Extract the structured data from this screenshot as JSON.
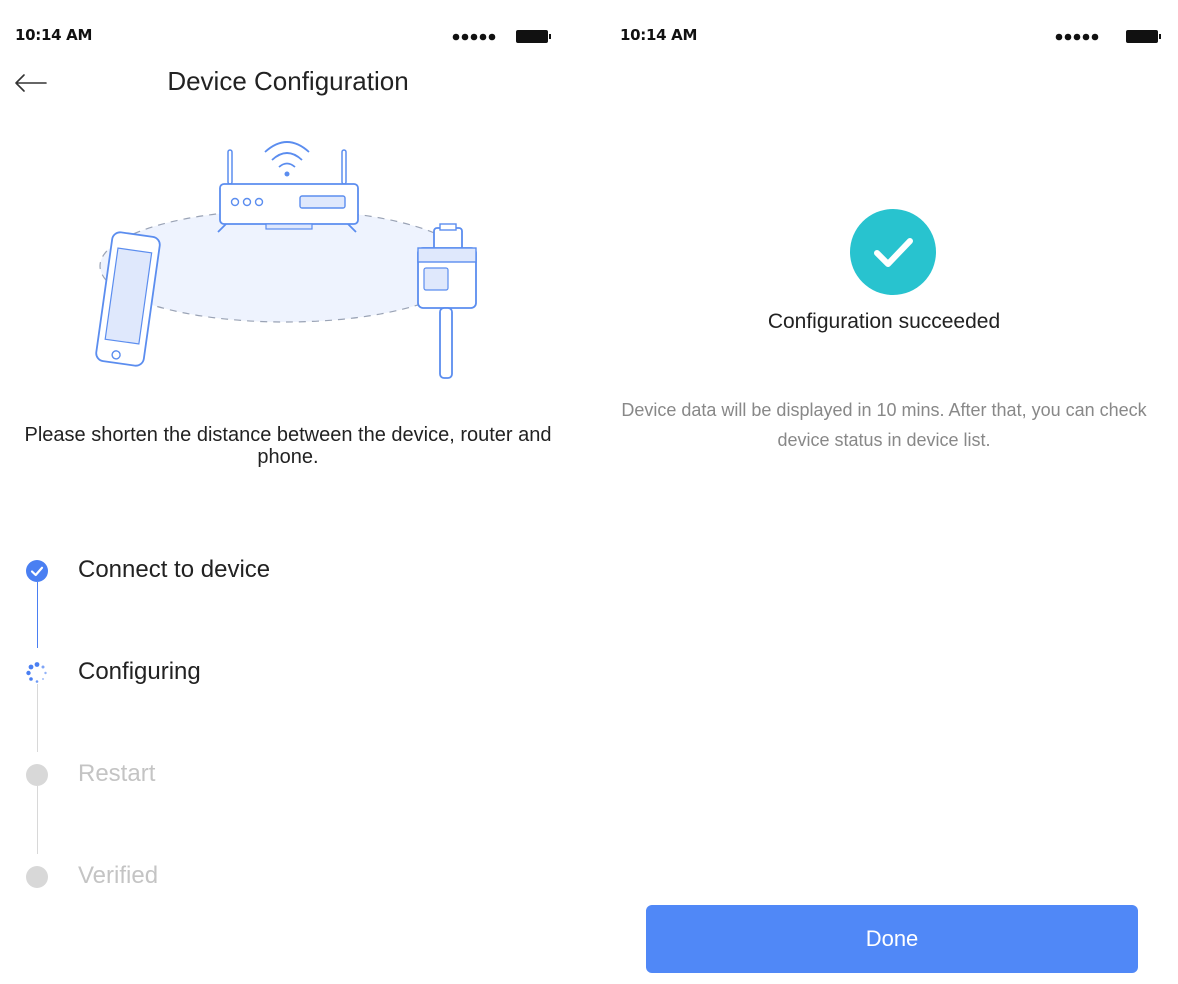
{
  "left": {
    "status": {
      "time": "10:14 AM"
    },
    "header": {
      "title": "Device Configuration"
    },
    "hint": "Please shorten the distance between the device, router and phone.",
    "steps": [
      {
        "label": "Connect to device",
        "state": "done"
      },
      {
        "label": "Configuring",
        "state": "in-progress"
      },
      {
        "label": "Restart",
        "state": "pending"
      },
      {
        "label": "Verified",
        "state": "pending"
      }
    ]
  },
  "right": {
    "status": {
      "time": "10:14 AM"
    },
    "result": {
      "title": "Configuration succeeded",
      "description": "Device data will be displayed in 10 mins. After that, you can check device status in device list."
    },
    "done_label": "Done"
  },
  "colors": {
    "accent": "#5088f7",
    "success": "#28c3cf",
    "step_done": "#4a7ff2",
    "step_pending": "#d8d8d8"
  },
  "icons": [
    "back-arrow-icon",
    "signal-icon",
    "battery-icon",
    "router-icon",
    "phone-icon",
    "device-icon",
    "check-icon",
    "spinner-icon"
  ]
}
